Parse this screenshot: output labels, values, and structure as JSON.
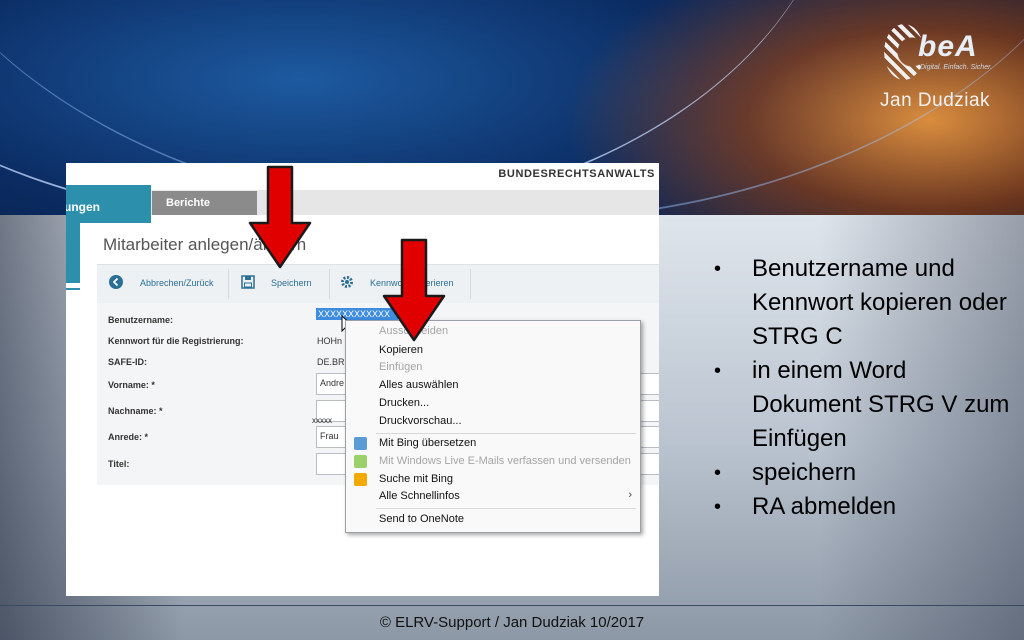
{
  "slide": {
    "footer": "© ELRV-Support / Jan Dudziak 10/2017",
    "logo": {
      "brand": "beA",
      "tagline": "Digital. Einfach. Sicher.",
      "author": "Jan Dudziak"
    },
    "bullets": [
      "Benutzername und Kennwort kopieren oder STRG C",
      "in einem Word Dokument STRG V zum Einfügen",
      "speichern",
      "RA abmelden"
    ]
  },
  "app": {
    "brand": "BUNDESRECHTSANWALTS",
    "tabs": {
      "active": "ungen",
      "reports": "Berichte"
    },
    "page_title": "Mitarbeiter anlegen/ändern",
    "toolbar": {
      "back": "Abbrechen/Zurück",
      "save": "Speichern",
      "password": "Kennwort generieren"
    },
    "form": {
      "labels": {
        "username": "Benutzername:",
        "reg_password": "Kennwort für die Registrierung:",
        "safe_id": "SAFE-ID:",
        "firstname": "Vorname: *",
        "lastname": "Nachname: *",
        "salutation": "Anrede: *",
        "title": "Titel:"
      },
      "values": {
        "username": "XXXXXXXXXXXX",
        "reg_password": "HOHn",
        "safe_id": "DE.BR",
        "firstname": "Andre",
        "lastname_overlay": "xxxxx",
        "salutation": "Frau",
        "title": ""
      }
    },
    "context_menu": {
      "items": [
        {
          "label": "Ausschneiden",
          "enabled": false
        },
        {
          "label": "Kopieren",
          "enabled": true
        },
        {
          "label": "Einfügen",
          "enabled": false
        },
        {
          "label": "Alles auswählen",
          "enabled": true
        },
        {
          "label": "Drucken...",
          "enabled": true
        },
        {
          "label": "Druckvorschau...",
          "enabled": true
        },
        {
          "label": "Mit Bing übersetzen",
          "enabled": true
        },
        {
          "label": "Mit Windows Live E-Mails verfassen und versenden",
          "enabled": false
        },
        {
          "label": "Suche mit Bing",
          "enabled": true
        },
        {
          "label": "Alle Schnellinfos",
          "enabled": true
        },
        {
          "label": "Send to OneNote",
          "enabled": true
        }
      ]
    }
  },
  "colors": {
    "accent": "#2c90ad",
    "arrow": "#e10000",
    "selection": "#3e8ce0"
  }
}
